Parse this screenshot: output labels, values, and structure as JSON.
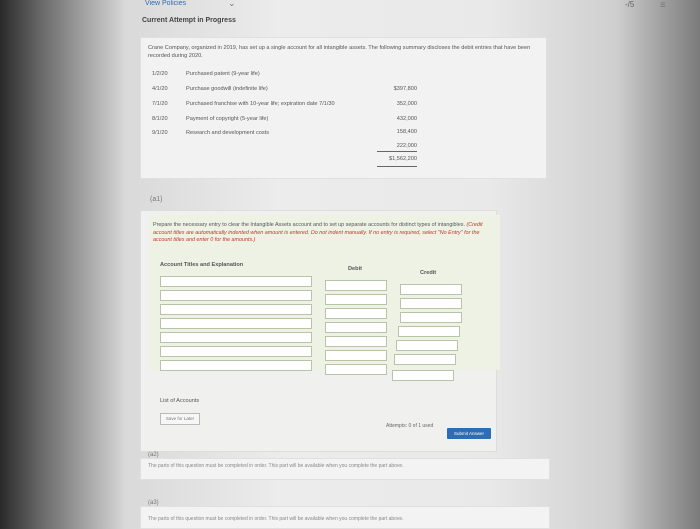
{
  "header": {
    "view_policies": "View Policies",
    "page_indicator": "-/5",
    "menu_icon": "≡",
    "current_attempt": "Current Attempt in Progress"
  },
  "problem": {
    "intro": "Crane Company, organized in 2019, has set up a single account for all intangible assets. The following summary discloses the debit entries that have been recorded during 2020.",
    "entries": [
      {
        "date": "1/2/20",
        "description": "Purchased patent (9-year life)",
        "amount": "$397,800"
      },
      {
        "date": "4/1/20",
        "description": "Purchase goodwill (indefinite life)",
        "amount": "352,000"
      },
      {
        "date": "7/1/20",
        "description": "Purchased franchise with 10-year life; expiration date 7/1/30",
        "amount": "432,000"
      },
      {
        "date": "8/1/20",
        "description": "Payment of copyright (5-year life)",
        "amount": "158,400"
      },
      {
        "date": "9/1/20",
        "description": "Research and development costs",
        "amount": "222,000"
      }
    ],
    "total": "$1,562,200"
  },
  "part_a1": {
    "label": "(a1)",
    "instructions": "Prepare the necessary entry to clear the Intangible Assets account and to set up separate accounts for distinct types of intangibles.",
    "instructions_note": "(Credit account titles are automatically indented when amount is entered. Do not indent manually. If no entry is required, select \"No Entry\" for the account titles and enter 0 for the amounts.)",
    "col_account": "Account Titles and Explanation",
    "col_debit": "Debit",
    "col_credit": "Credit",
    "rows": [
      {
        "account": "",
        "debit": "",
        "credit": ""
      },
      {
        "account": "",
        "debit": "",
        "credit": ""
      },
      {
        "account": "",
        "debit": "",
        "credit": ""
      },
      {
        "account": "",
        "debit": "",
        "credit": ""
      },
      {
        "account": "",
        "debit": "",
        "credit": ""
      },
      {
        "account": "",
        "debit": "",
        "credit": ""
      },
      {
        "account": "",
        "debit": "",
        "credit": ""
      }
    ],
    "list_of_accounts": "List of Accounts",
    "save_for_later": "Save for Later",
    "attempts": "Attempts: 0 of 1 used",
    "submit": "Submit Answer"
  },
  "part_a2": {
    "label": "(a2)",
    "text": "The parts of this question must be completed in order. This part will be available when you complete the part above."
  },
  "part_a3": {
    "label": "(a3)",
    "text": "The parts of this question must be completed in order. This part will be available when you complete the part above."
  },
  "colors": {
    "accent": "#2d6db5",
    "panel": "#f0f0ee",
    "field_border": "#b8c4a8"
  }
}
